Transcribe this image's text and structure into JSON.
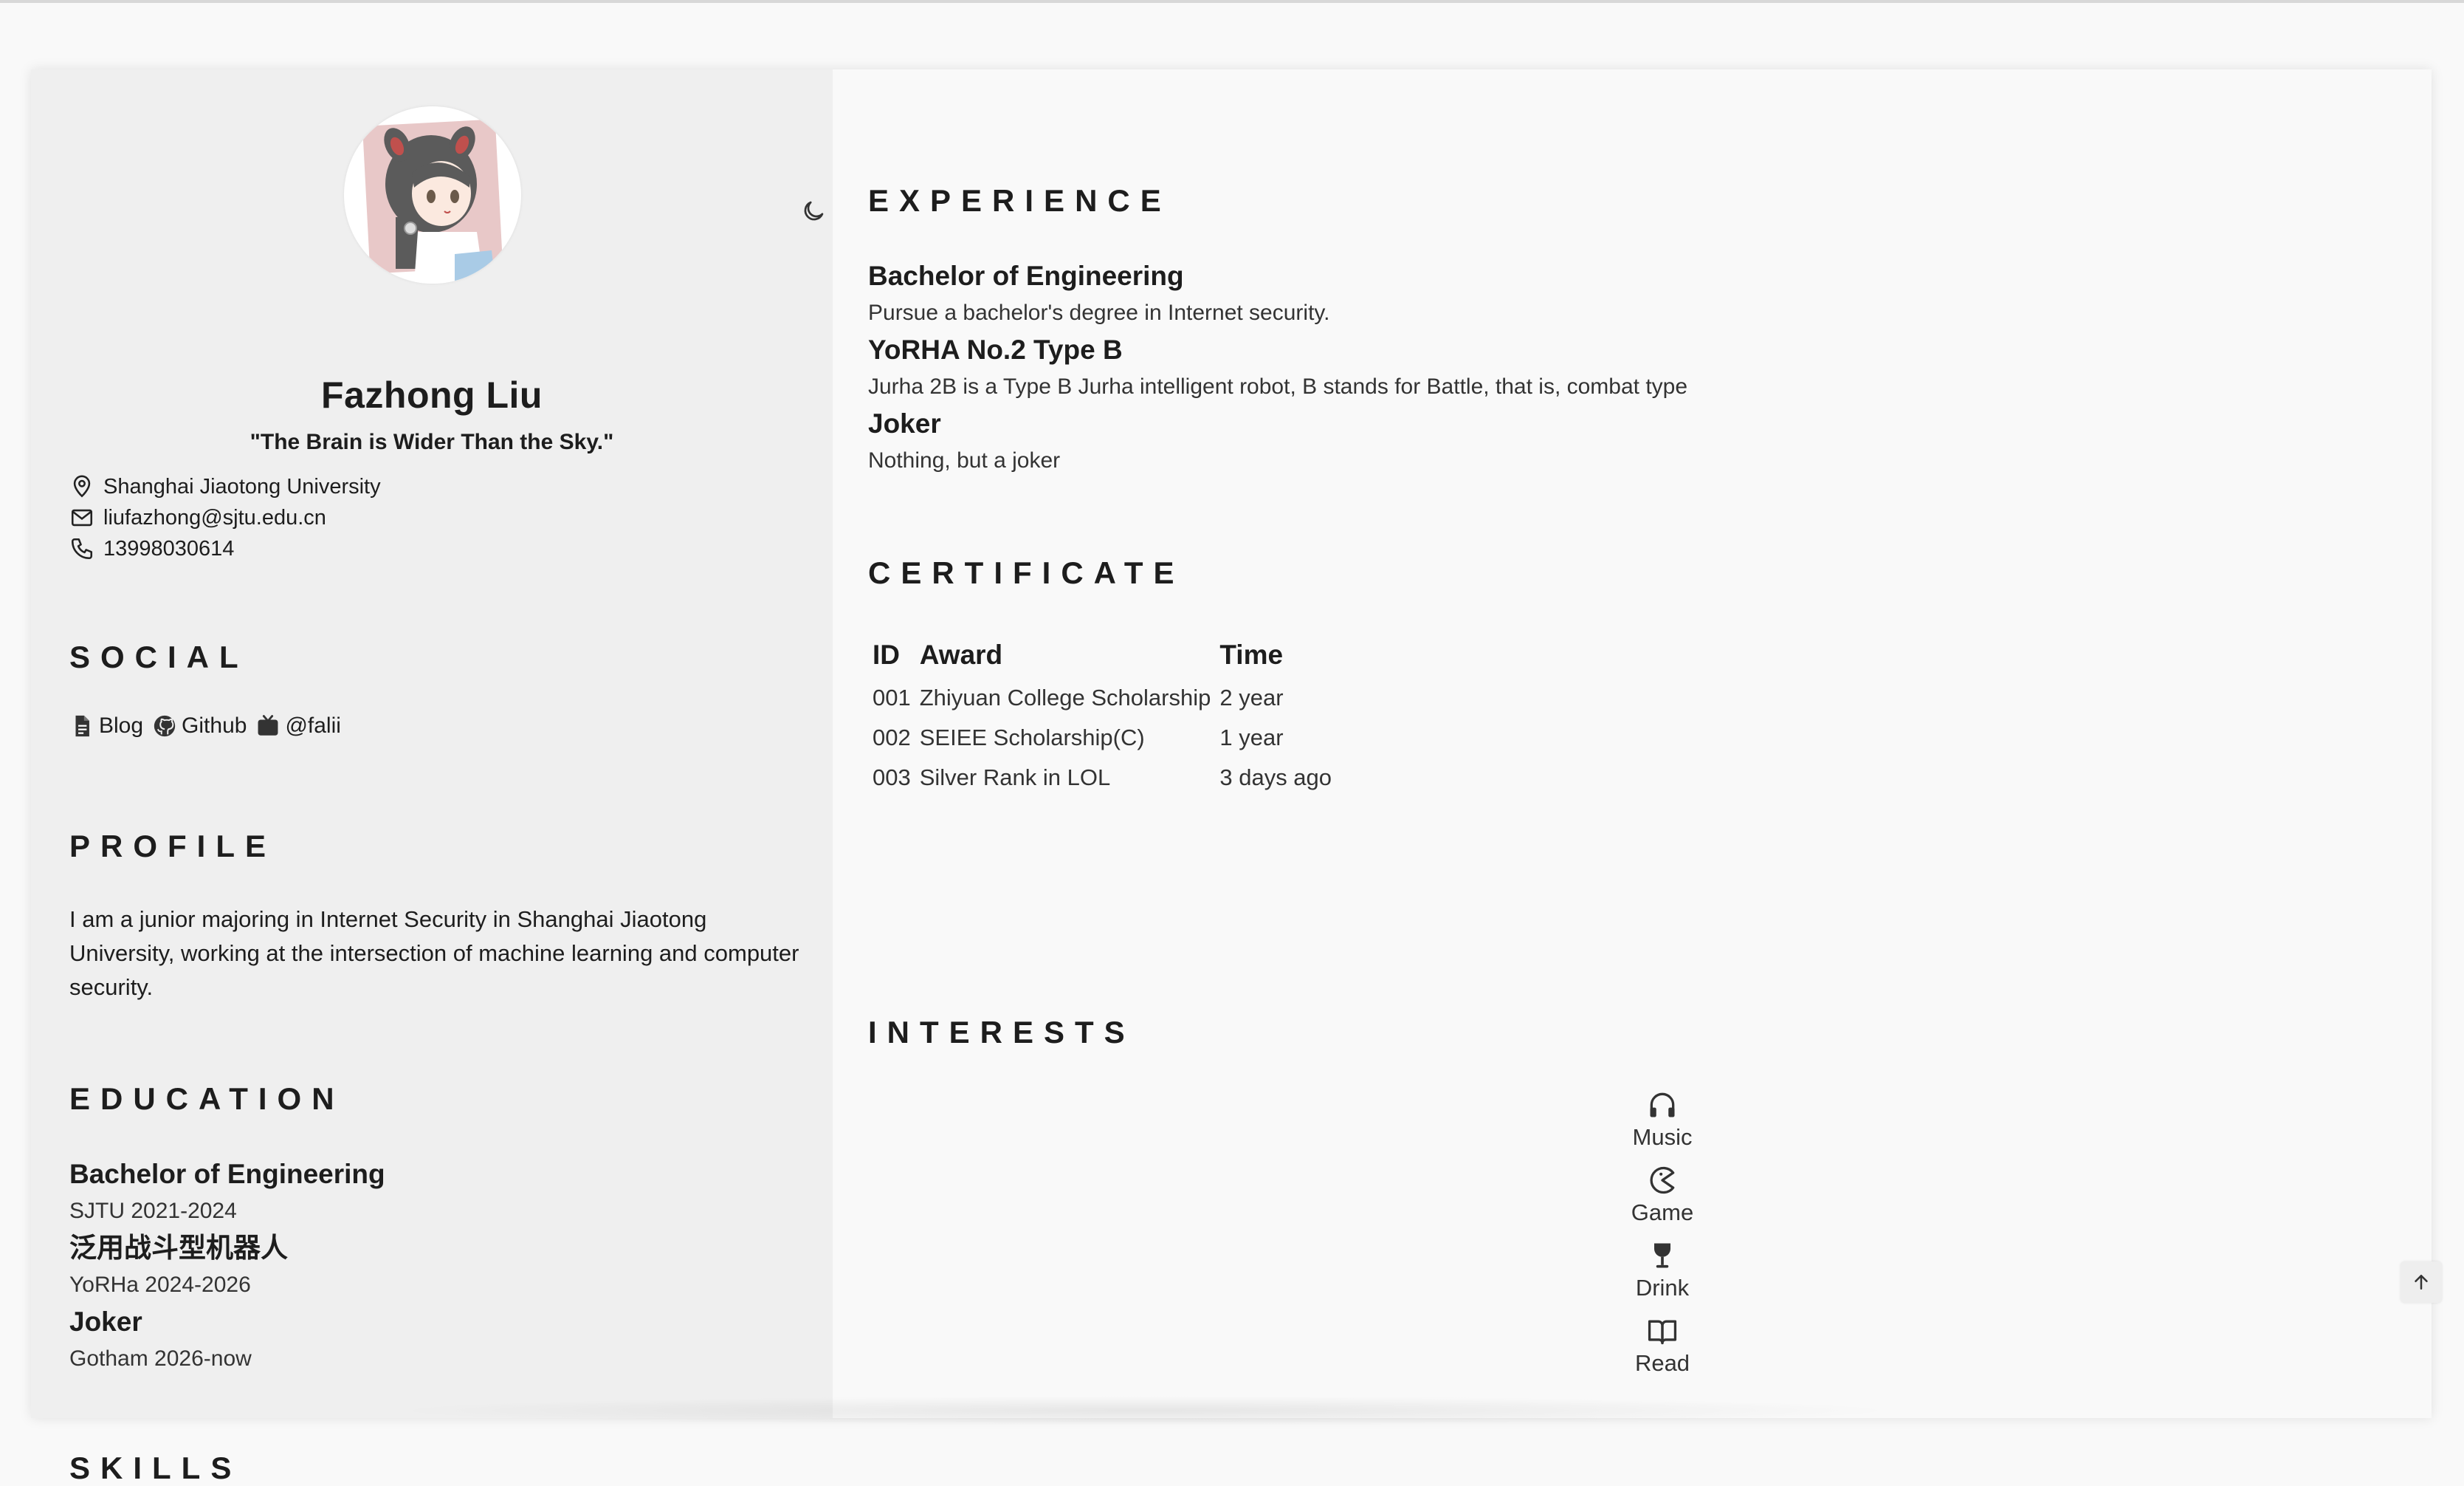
{
  "profile": {
    "name": "Fazhong Liu",
    "motto": "\"The Brain is Wider Than the Sky.\"",
    "location": "Shanghai Jiaotong University",
    "email": "liufazhong@sjtu.edu.cn",
    "phone": "13998030614"
  },
  "social": {
    "title": "SOCIAL",
    "links": [
      {
        "label": "Blog",
        "icon": "document-icon"
      },
      {
        "label": "Github",
        "icon": "github-icon"
      },
      {
        "label": "@falii",
        "icon": "tv-icon"
      }
    ]
  },
  "profile_section": {
    "title": "PROFILE",
    "text": "I am a junior majoring in Internet Security in Shanghai Jiaotong University, working at the intersection of machine learning and computer security."
  },
  "education": {
    "title": "EDUCATION",
    "items": [
      {
        "title": "Bachelor of Engineering",
        "sub": "SJTU 2021-2024"
      },
      {
        "title": "泛用战斗型机器人",
        "sub": "YoRHa 2024-2026"
      },
      {
        "title": "Joker",
        "sub": "Gotham 2026-now"
      }
    ]
  },
  "skills": {
    "title": "SKILLS"
  },
  "experience": {
    "title": "EXPERIENCE",
    "items": [
      {
        "title": "Bachelor of Engineering",
        "desc": "Pursue a bachelor's degree in Internet security."
      },
      {
        "title": "YoRHA No.2 Type B",
        "desc": "Jurha 2B is a Type B Jurha intelligent robot, B stands for Battle, that is, combat type"
      },
      {
        "title": "Joker",
        "desc": "Nothing, but a joker"
      }
    ]
  },
  "certificate": {
    "title": "CERTIFICATE",
    "headers": [
      "ID",
      "Award",
      "Time"
    ],
    "rows": [
      [
        "001",
        "Zhiyuan College Scholarship",
        "2 year"
      ],
      [
        "002",
        "SEIEE Scholarship(C)",
        "1 year"
      ],
      [
        "003",
        "Silver Rank in LOL",
        "3 days ago"
      ]
    ]
  },
  "interests": {
    "title": "INTERESTS",
    "items": [
      {
        "label": "Music",
        "icon": "headphones-icon"
      },
      {
        "label": "Game",
        "icon": "pacman-icon"
      },
      {
        "label": "Drink",
        "icon": "wine-glass-icon"
      },
      {
        "label": "Read",
        "icon": "open-book-icon"
      }
    ]
  },
  "colors": {
    "sidebar_bg": "#efefef",
    "main_bg": "#f9f9f9",
    "text": "#1d1d1d"
  }
}
